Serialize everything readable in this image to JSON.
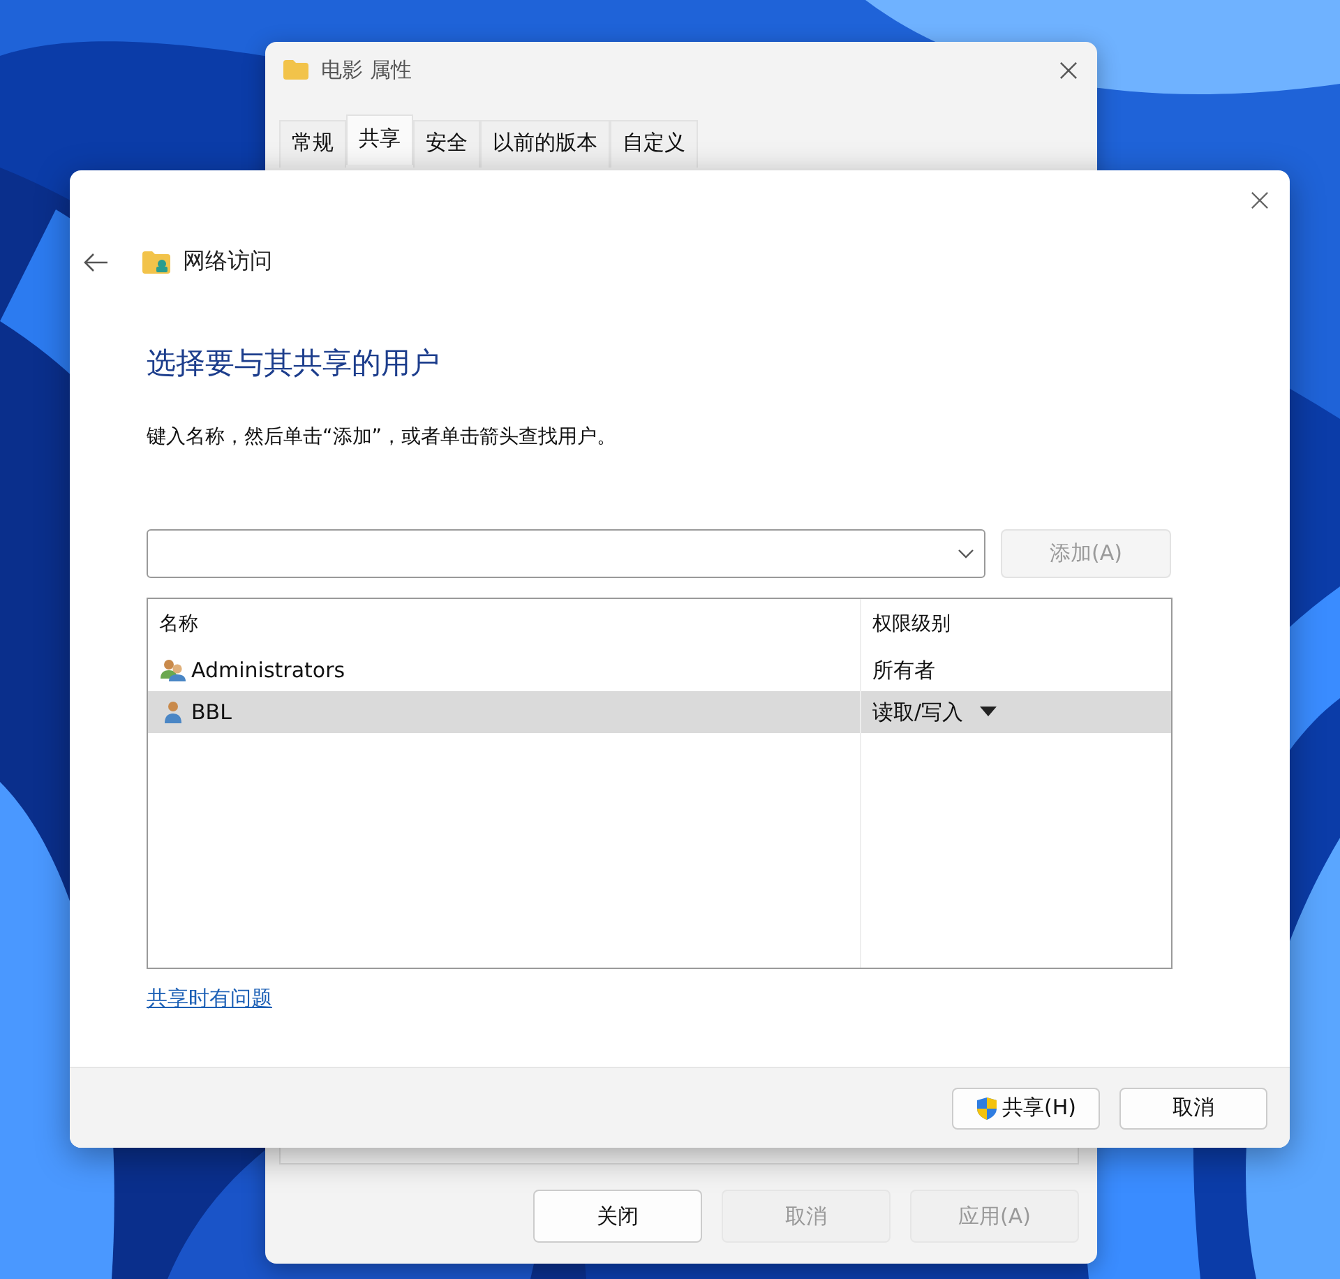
{
  "back_window": {
    "title": "电影 属性",
    "tabs": [
      {
        "label": "常规",
        "selected": false
      },
      {
        "label": "共享",
        "selected": true
      },
      {
        "label": "安全",
        "selected": false
      },
      {
        "label": "以前的版本",
        "selected": false
      },
      {
        "label": "自定义",
        "selected": false
      }
    ],
    "buttons": [
      {
        "label": "关闭",
        "disabled": false
      },
      {
        "label": "取消",
        "disabled": true
      },
      {
        "label": "应用(A)",
        "disabled": true
      }
    ]
  },
  "dialog": {
    "nav_title": "网络访问",
    "heading": "选择要与其共享的用户",
    "instruction": "键入名称，然后单击“添加”，或者单击箭头查找用户。",
    "add_button": {
      "label": "添加(A)",
      "disabled": true
    },
    "table": {
      "columns": [
        "名称",
        "权限级别"
      ],
      "rows": [
        {
          "name": "Administrators",
          "kind": "group",
          "permission": "所有者",
          "selected": false
        },
        {
          "name": "BBL",
          "kind": "user",
          "permission": "读取/写入",
          "selected": true
        }
      ]
    },
    "help_link": "共享时有问题",
    "buttons": [
      {
        "label": "共享(H)",
        "shield": true
      },
      {
        "label": "取消",
        "shield": false
      }
    ]
  }
}
